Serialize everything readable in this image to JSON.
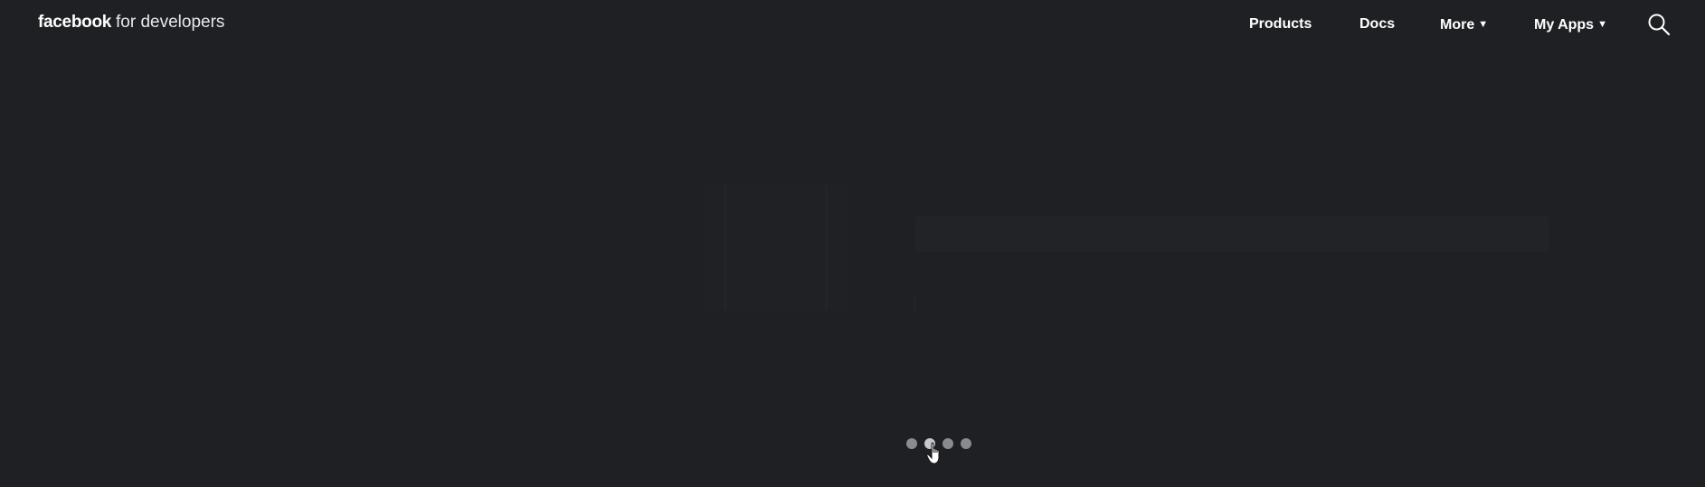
{
  "header": {
    "logo": {
      "brand": "facebook",
      "suffix": "for developers"
    },
    "nav": {
      "products": "Products",
      "docs": "Docs",
      "more": "More",
      "my_apps": "My Apps"
    },
    "icons": {
      "search": "search-icon",
      "caret": "caret-down-icon"
    }
  },
  "carousel": {
    "slide_count": 4,
    "active_index": 1
  },
  "colors": {
    "background": "#1f2024",
    "text": "#ffffff",
    "dot_inactive": "#8a8b8f",
    "dot_active": "#c7c8cb"
  }
}
